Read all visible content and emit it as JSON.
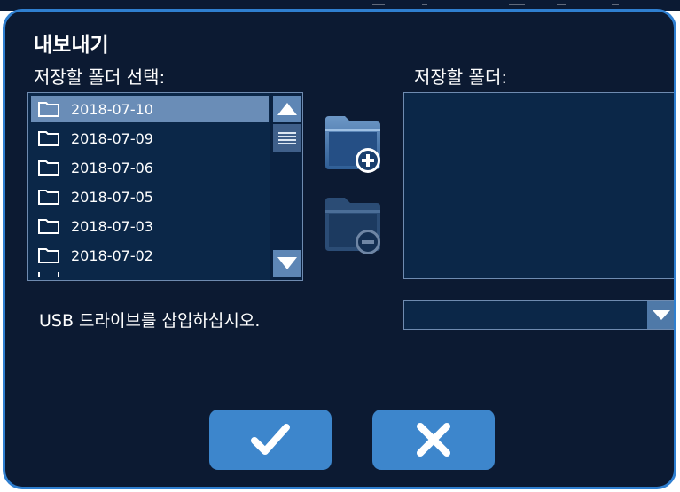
{
  "dialog": {
    "title": "내보내기",
    "select_folder_label": "저장할 폴더 선택:",
    "save_folder_label": "저장할 폴더:",
    "usb_message": "USB 드라이브를 삽입하십시오."
  },
  "folders": [
    {
      "name": "2018-07-10",
      "selected": true
    },
    {
      "name": "2018-07-09",
      "selected": false
    },
    {
      "name": "2018-07-06",
      "selected": false
    },
    {
      "name": "2018-07-05",
      "selected": false
    },
    {
      "name": "2018-07-03",
      "selected": false
    },
    {
      "name": "2018-07-02",
      "selected": false
    }
  ],
  "saved_folders": [],
  "drive_select": {
    "value": ""
  },
  "icons": {
    "folder": "folder-icon",
    "add_folder": "folder-add-icon",
    "remove_folder": "folder-remove-icon",
    "confirm": "checkmark-icon",
    "cancel": "close-icon",
    "scroll_up": "triangle-up-icon",
    "scroll_down": "triangle-down-icon",
    "dropdown": "chevron-down-icon"
  },
  "colors": {
    "background": "#0c1a32",
    "border": "#2f7fd0",
    "list_background": "#0b2748",
    "selected_row": "#6a8db7",
    "button": "#3d86cc"
  }
}
